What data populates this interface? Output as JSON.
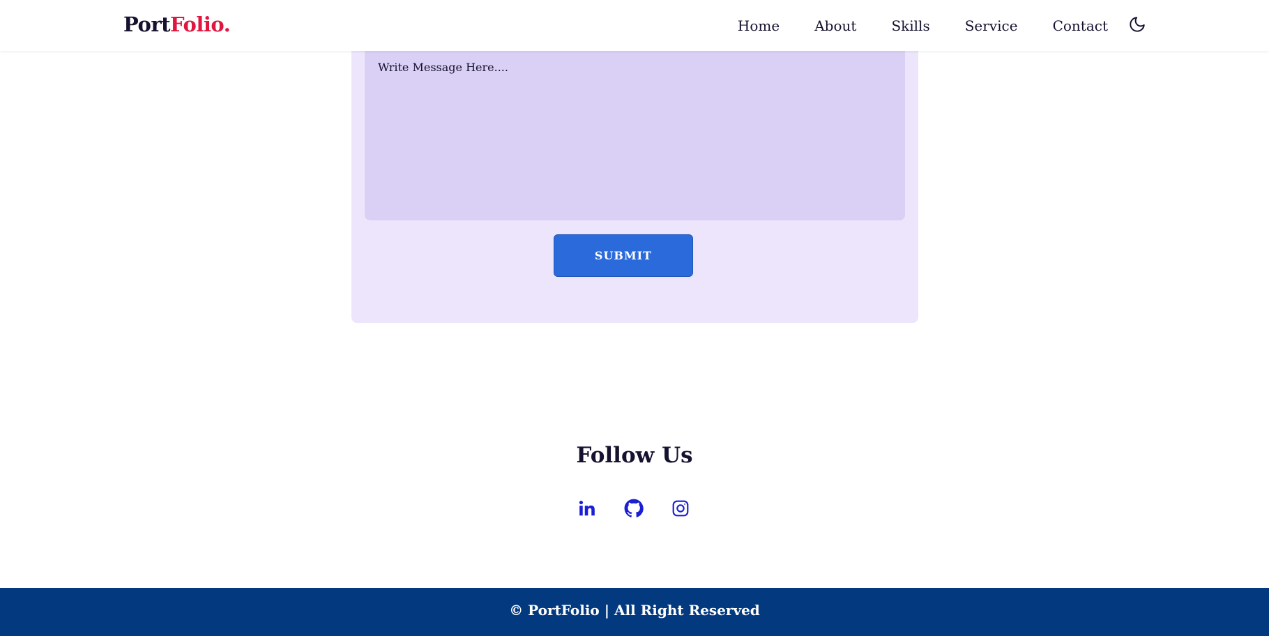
{
  "header": {
    "logo_part1": "Port",
    "logo_part2": "Folio.",
    "nav": [
      "Home",
      "About",
      "Skills",
      "Service",
      "Contact"
    ],
    "theme_icon": "moon-icon"
  },
  "contact_form": {
    "message_placeholder": "Write Message Here....",
    "message_value": "",
    "submit_label": "SUBMIT"
  },
  "follow": {
    "title": "Follow Us",
    "icons": [
      "linkedin-icon",
      "github-icon",
      "instagram-icon"
    ]
  },
  "footer": {
    "text": "© PortFolio | All Right Reserved"
  },
  "colors": {
    "brand_red": "#e0163f",
    "card_bg": "#ede5fb",
    "textarea_bg": "#dacff5",
    "button_blue": "#2a6adb",
    "icon_blue": "#1a1fd6",
    "footer_bg": "#033a7f",
    "text_dark": "#14122e"
  }
}
